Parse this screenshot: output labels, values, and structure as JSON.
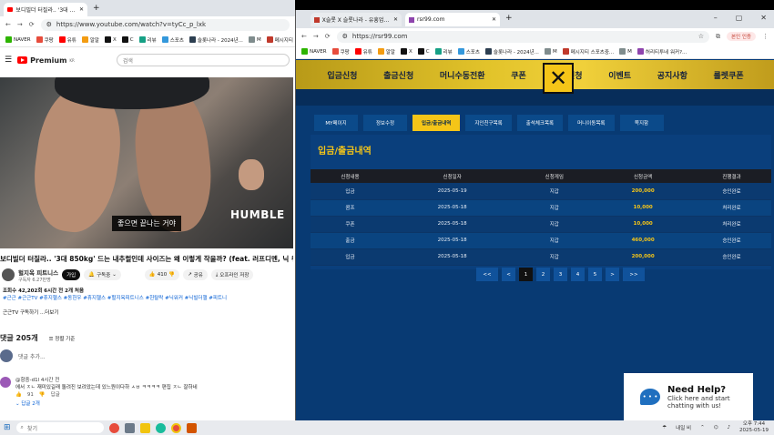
{
  "left_window": {
    "tab_title": "보디빌더 터질라.. '3대 85...",
    "url": "https://www.youtube.com/watch?v=tyCc_p_lxk",
    "bookmarks": [
      "NAVER",
      "쿠팡",
      "유튜",
      "알알",
      "X",
      "C",
      "리뷰",
      "스포츠",
      "슬롯나라 - 2024년...",
      "M",
      "메시지티 스..."
    ],
    "logo_text": "Premium",
    "logo_sup": "KR",
    "search_placeholder": "검색",
    "video_caption": "좋으면 끝나는 거야",
    "video_watermark": "HUMBLE",
    "video_title": "보디빌더 터질라.. '3대 850kg' 드는 내추럴인데 사이즈는 왜 이렇게 작을까? (feat. 러프디멘, 닉 워커",
    "channel": "헐지옥 피트니스",
    "subscribers": "구독자 6.27만명",
    "join_label": "가입",
    "subscribed_label": "구독중",
    "likes": "410",
    "share_label": "공유",
    "offline_label": "오프라인 저장",
    "desc_line1": "조회수 42,202회  6시간 전  2개 처음",
    "desc_tags": "#근근 #근근TV #휴지헬스 #동헌우 #휴지헬스 #헐지옥피트니스 #헌탈락 #닉워커 #닉빌더챌 #피트니",
    "desc_line3": "근근TV 구독하기 ...더보기",
    "comments_count": "댓글 205개",
    "sort_label": "정렬 기준",
    "add_comment": "댓글 추가...",
    "comment_author": "@항중-d1l  4시간 전",
    "comment_text": "에서 ㅈㄴ 재미있길래 돌려진 보려았는데 있느원이다하 ㅅㅂ ㅋㅋㅋㅋ 편집 ㅈㄴ 잘하네",
    "comment_likes": "91",
    "reply_label": "답글",
    "replies_label": "답글 2개"
  },
  "right_window": {
    "tab1_title": "X슬롯 X 슬롯나라 - 유흥업 2...",
    "tab2_title": "rsr99.com",
    "url": "https://rsr99.com",
    "window_controls": [
      "–",
      "▢",
      "✕"
    ],
    "profile_label": "본인 인증",
    "bookmarks": [
      "NAVER",
      "쿠팡",
      "유튜",
      "알알",
      "X",
      "C",
      "리뷰",
      "스포츠",
      "슬롯나라 - 2024년...",
      "M",
      "메시지티 스포츠중...",
      "M",
      "허리티투네 워커?..."
    ],
    "nav": [
      "입금신청",
      "출금신청",
      "머니수동전환",
      "쿠폰",
      "콤프신청",
      "이벤트",
      "공지사항",
      "룰렛쿠폰"
    ],
    "subtabs": [
      "MY페이지",
      "정보수정",
      "입금/출금내역",
      "지인친구목록",
      "출석체크목록",
      "머니이동목록",
      "쪽지함"
    ],
    "active_subtab": 2,
    "panel_title": "입금/출금내역",
    "columns": [
      "신청내용",
      "신청일자",
      "신청게임",
      "신청금액",
      "진행결과"
    ],
    "rows": [
      [
        "입금",
        "2025-05-19",
        "지갑",
        "200,000",
        "승인완료"
      ],
      [
        "콤프",
        "2025-05-18",
        "지갑",
        "10,000",
        "처리완료"
      ],
      [
        "쿠폰",
        "2025-05-18",
        "지갑",
        "10,000",
        "처리완료"
      ],
      [
        "출금",
        "2025-05-18",
        "지갑",
        "460,000",
        "승인완료"
      ],
      [
        "입금",
        "2025-05-18",
        "지갑",
        "200,000",
        "승인완료"
      ]
    ],
    "pager": [
      "<<",
      "<",
      "1",
      "2",
      "3",
      "4",
      "5",
      ">",
      ">>"
    ],
    "active_page": "1",
    "help_title": "Need Help?",
    "help_sub1": "Click here and start",
    "help_sub2": "chatting with us!"
  },
  "taskbar": {
    "search_placeholder": "찾기",
    "weather": "내일 비",
    "time": "오후 7:44",
    "date": "2025-05-19"
  },
  "colors": {
    "accent_yellow": "#f5c518",
    "site_bg": "#083a73",
    "youtube_red": "#ff0000"
  }
}
